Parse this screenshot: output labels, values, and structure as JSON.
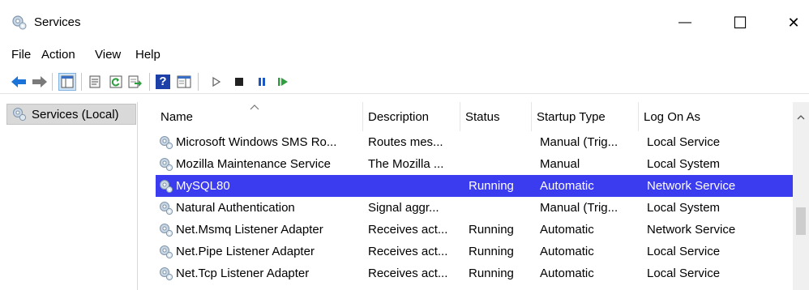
{
  "window": {
    "title": "Services",
    "minimize_glyph": "—",
    "maximize_glyph": "☐",
    "close_glyph": "✕"
  },
  "menu": [
    "File",
    "Action",
    "View",
    "Help"
  ],
  "toolbar": {
    "buttons": [
      "back-icon",
      "forward-icon",
      "show-hide-console-tree-icon",
      "properties-icon",
      "refresh-icon",
      "export-list-icon",
      "help-icon",
      "show-hide-action-pane-icon",
      "start-service-icon",
      "stop-service-icon",
      "pause-service-icon",
      "restart-service-icon"
    ],
    "help_glyph": "?"
  },
  "tree": {
    "label": "Services (Local)"
  },
  "columns": [
    "Name",
    "Description",
    "Status",
    "Startup Type",
    "Log On As"
  ],
  "rows": [
    {
      "name": "Microsoft Windows SMS Ro...",
      "description": "Routes mes...",
      "status": "",
      "startup": "Manual (Trig...",
      "logon": "Local Service"
    },
    {
      "name": "Mozilla Maintenance Service",
      "description": "The Mozilla ...",
      "status": "",
      "startup": "Manual",
      "logon": "Local System"
    },
    {
      "name": "MySQL80",
      "description": "",
      "status": "Running",
      "startup": "Automatic",
      "logon": "Network Service"
    },
    {
      "name": "Natural Authentication",
      "description": "Signal aggr...",
      "status": "",
      "startup": "Manual (Trig...",
      "logon": "Local System"
    },
    {
      "name": "Net.Msmq Listener Adapter",
      "description": "Receives act...",
      "status": "Running",
      "startup": "Automatic",
      "logon": "Network Service"
    },
    {
      "name": "Net.Pipe Listener Adapter",
      "description": "Receives act...",
      "status": "Running",
      "startup": "Automatic",
      "logon": "Local Service"
    },
    {
      "name": "Net.Tcp Listener Adapter",
      "description": "Receives act...",
      "status": "Running",
      "startup": "Automatic",
      "logon": "Local Service"
    }
  ],
  "selected_row": 2,
  "colors": {
    "selection": "#3b3bf0",
    "accent_blue": "#1a73d9",
    "green": "#2e9e3e"
  }
}
